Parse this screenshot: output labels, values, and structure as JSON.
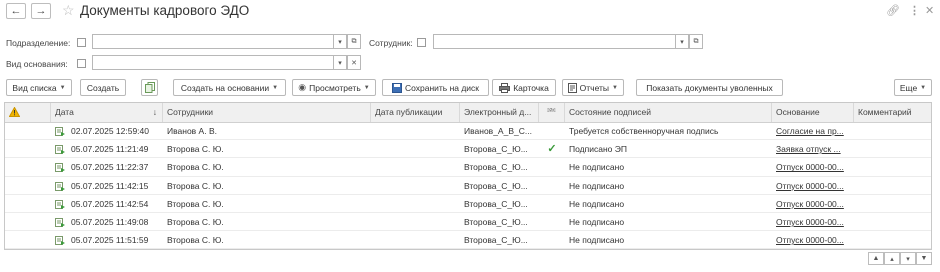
{
  "title": "Документы кадрового ЭДО",
  "filters": {
    "department_label": "Подразделение:",
    "employee_label": "Сотрудник:",
    "basis_type_label": "Вид основания:"
  },
  "toolbar": {
    "list_view": "Вид списка",
    "create": "Создать",
    "create_based_on": "Создать на основании",
    "view": "Просмотреть",
    "save_to_disk": "Сохранить на диск",
    "card": "Карточка",
    "reports": "Отчеты",
    "show_fired": "Показать документы уволенных",
    "more": "Еще"
  },
  "columns": {
    "date": "Дата",
    "employees": "Сотрудники",
    "publish_date": "Дата публикации",
    "electronic_doc": "Электронный д...",
    "sign_state": "Состояние подписей",
    "basis": "Основание",
    "comment": "Комментарий"
  },
  "rows": [
    {
      "date": "02.07.2025 12:59:40",
      "employee": "Иванов А. В.",
      "edoc": "Иванов_А_В_С...",
      "signed": false,
      "state": "Требуется собственноручная подпись",
      "basis": "Согласие на пр..."
    },
    {
      "date": "05.07.2025 11:21:49",
      "employee": "Второва С. Ю.",
      "edoc": "Второва_С_Ю...",
      "signed": true,
      "state": "Подписано ЭП",
      "basis": "Заявка отпуск ..."
    },
    {
      "date": "05.07.2025 11:22:37",
      "employee": "Второва С. Ю.",
      "edoc": "Второва_С_Ю...",
      "signed": false,
      "state": "Не подписано",
      "basis": "Отпуск 0000-00..."
    },
    {
      "date": "05.07.2025 11:42:15",
      "employee": "Второва С. Ю.",
      "edoc": "Второва_С_Ю...",
      "signed": false,
      "state": "Не подписано",
      "basis": "Отпуск 0000-00..."
    },
    {
      "date": "05.07.2025 11:42:54",
      "employee": "Второва С. Ю.",
      "edoc": "Второва_С_Ю...",
      "signed": false,
      "state": "Не подписано",
      "basis": "Отпуск 0000-00..."
    },
    {
      "date": "05.07.2025 11:49:08",
      "employee": "Второва С. Ю.",
      "edoc": "Второва_С_Ю...",
      "signed": false,
      "state": "Не подписано",
      "basis": "Отпуск 0000-00..."
    },
    {
      "date": "05.07.2025 11:51:59",
      "employee": "Второва С. Ю.",
      "edoc": "Второва_С_Ю...",
      "signed": false,
      "state": "Не подписано",
      "basis": "Отпуск 0000-00..."
    }
  ],
  "colors": {
    "accent_check": "#3a9a3a",
    "warning": "#f0b400"
  }
}
